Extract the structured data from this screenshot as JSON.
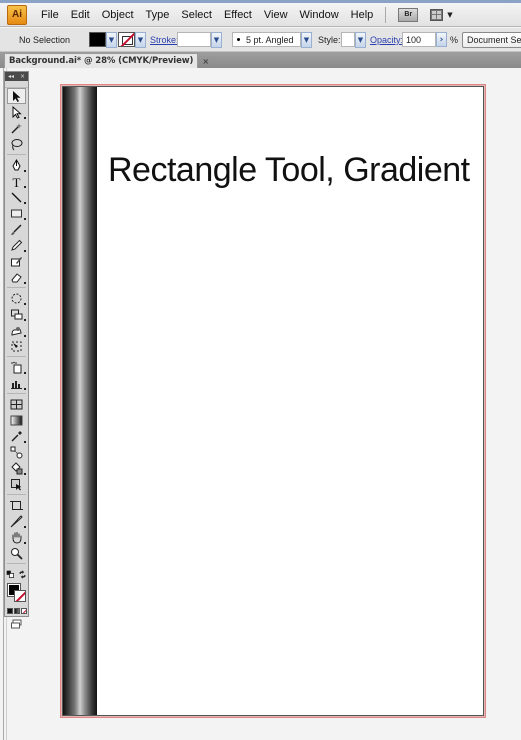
{
  "app": {
    "logo": "Ai",
    "accent_color": "#f0a02a"
  },
  "menubar": {
    "items": [
      "File",
      "Edit",
      "Object",
      "Type",
      "Select",
      "Effect",
      "View",
      "Window",
      "Help"
    ],
    "bridge_label": "Br",
    "arrange_icon": "arrange-documents-icon"
  },
  "controlbar": {
    "selection_label": "No Selection",
    "fill_color": "#000000",
    "stroke_color": "none",
    "stroke_label": "Stroke:",
    "stroke_value": "",
    "brush_value": "5 pt. Angled",
    "style_label": "Style:",
    "opacity_label": "Opacity:",
    "opacity_value": "100",
    "opacity_unit": "%",
    "document_setup_label": "Document Setup"
  },
  "document_tab": {
    "title": "Background.ai* @ 28% (CMYK/Preview)",
    "close_glyph": "×"
  },
  "toolbox": {
    "collapse_glyph": "◂◂",
    "close_glyph": "×",
    "tools": [
      {
        "name": "selection-tool",
        "icon": "arrow-icon",
        "active": true
      },
      {
        "name": "direct-selection-tool",
        "icon": "hollow-arrow-icon"
      },
      {
        "name": "magic-wand-tool",
        "icon": "magic-wand-icon"
      },
      {
        "name": "lasso-tool",
        "icon": "lasso-icon"
      },
      {
        "name": "pen-tool",
        "icon": "pen-icon"
      },
      {
        "name": "type-tool",
        "icon": "type-icon"
      },
      {
        "name": "line-segment-tool",
        "icon": "line-icon"
      },
      {
        "name": "rectangle-tool",
        "icon": "rectangle-icon"
      },
      {
        "name": "paintbrush-tool",
        "icon": "brush-icon"
      },
      {
        "name": "pencil-tool",
        "icon": "pencil-icon"
      },
      {
        "name": "blob-brush-tool",
        "icon": "blob-brush-icon"
      },
      {
        "name": "eraser-tool",
        "icon": "eraser-icon"
      },
      {
        "name": "rotate-tool",
        "icon": "rotate-icon"
      },
      {
        "name": "scale-tool",
        "icon": "scale-icon"
      },
      {
        "name": "warp-tool",
        "icon": "warp-icon"
      },
      {
        "name": "free-transform-tool",
        "icon": "free-transform-icon"
      },
      {
        "name": "symbol-sprayer-tool",
        "icon": "symbol-sprayer-icon"
      },
      {
        "name": "column-graph-tool",
        "icon": "graph-icon"
      },
      {
        "name": "mesh-tool",
        "icon": "mesh-icon"
      },
      {
        "name": "gradient-tool",
        "icon": "gradient-icon"
      },
      {
        "name": "eyedropper-tool",
        "icon": "eyedropper-icon"
      },
      {
        "name": "blend-tool",
        "icon": "blend-icon"
      },
      {
        "name": "live-paint-bucket-tool",
        "icon": "paint-bucket-icon"
      },
      {
        "name": "live-paint-selection-tool",
        "icon": "live-paint-selection-icon"
      },
      {
        "name": "crop-area-tool",
        "icon": "crop-icon"
      },
      {
        "name": "slice-tool",
        "icon": "knife-icon"
      },
      {
        "name": "hand-tool",
        "icon": "hand-icon"
      },
      {
        "name": "zoom-tool",
        "icon": "magnifier-icon"
      }
    ],
    "fill_color": "#000000",
    "stroke_color": "none"
  },
  "artboard": {
    "headline": "Rectangle Tool, Gradient",
    "gradient_stops": [
      "#111111",
      "#777777",
      "#cfcfcf",
      "#777777",
      "#111111"
    ],
    "border_color": "#d88888"
  }
}
